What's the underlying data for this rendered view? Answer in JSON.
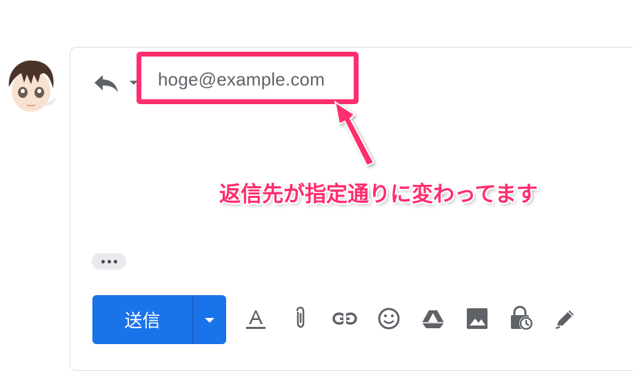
{
  "compose": {
    "recipient": "hoge@example.com",
    "send_label": "送信"
  },
  "annotation": {
    "text": "返信先が指定通りに変わってます",
    "color": "#ff2d6d"
  },
  "toolbar": {
    "icons": [
      "text-format-icon",
      "attach-icon",
      "link-icon",
      "emoji-icon",
      "drive-icon",
      "photo-icon",
      "confidential-mode-icon",
      "signature-icon"
    ]
  },
  "colors": {
    "send_button": "#1a73e8",
    "highlight": "#ff2d6d",
    "icon": "#5f6368"
  }
}
